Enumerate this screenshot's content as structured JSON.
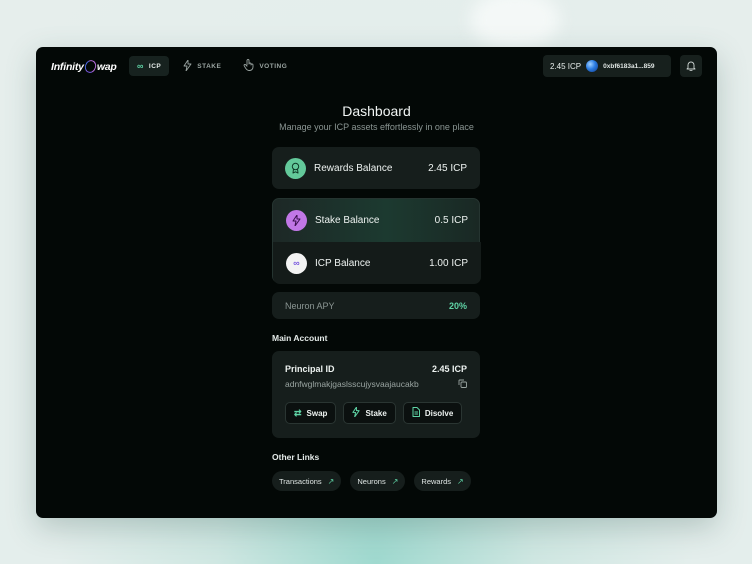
{
  "brand": {
    "name_prefix": "Infinity",
    "name_suffix": "wap"
  },
  "nav": [
    {
      "label": "ICP",
      "icon": "infinity-icon",
      "active": true
    },
    {
      "label": "STAKE",
      "icon": "lightning-icon",
      "active": false
    },
    {
      "label": "VOTING",
      "icon": "hand-pointer-icon",
      "active": false
    }
  ],
  "wallet": {
    "balance": "2.45 ICP",
    "address": "0xbf6183a1...859"
  },
  "dashboard": {
    "title": "Dashboard",
    "subtitle": "Manage your ICP assets effortlessly in one place"
  },
  "balances": {
    "rewards": {
      "label": "Rewards Balance",
      "value": "2.45 ICP"
    },
    "stake": {
      "label": "Stake Balance",
      "value": "0.5 ICP"
    },
    "icp": {
      "label": "ICP Balance",
      "value": "1.00 ICP"
    }
  },
  "apy": {
    "label": "Neuron APY",
    "value": "20%"
  },
  "main_account": {
    "heading": "Main Account",
    "principal_label": "Principal ID",
    "principal_value": "2.45 ICP",
    "principal_id": "adnfwglmakjgaslsscujysvaajaucakb",
    "actions": [
      {
        "label": "Swap",
        "icon": "swap-icon"
      },
      {
        "label": "Stake",
        "icon": "lightning-icon"
      },
      {
        "label": "Disolve",
        "icon": "document-icon"
      }
    ]
  },
  "other_links": {
    "heading": "Other Links",
    "items": [
      {
        "label": "Transactions"
      },
      {
        "label": "Neurons"
      },
      {
        "label": "Rewards"
      }
    ]
  },
  "colors": {
    "accent": "#5fd4a6",
    "background": "#030806",
    "card": "#161e1c"
  }
}
